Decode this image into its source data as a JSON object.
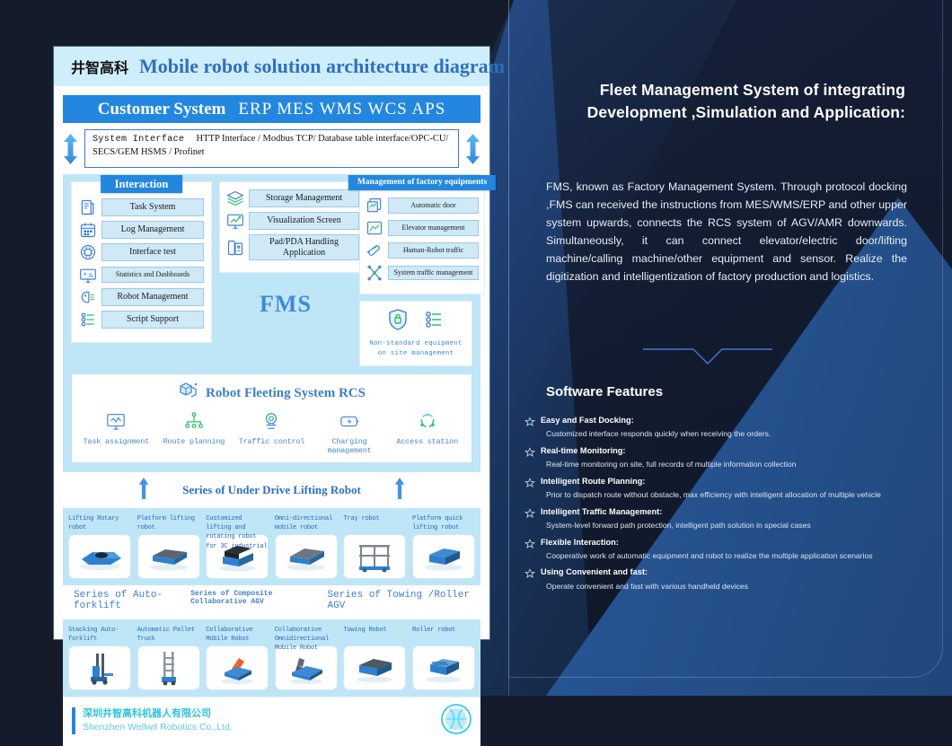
{
  "poster": {
    "brand_cn": "井智高科",
    "title": "Mobile robot solution architecture diagram",
    "customer_bar": {
      "label": "Customer System",
      "systems": "ERP  MES  WMS WCS APS"
    },
    "system_interface": {
      "label": "System Interface",
      "line1": "HTTP Interface / Modbus TCP/ Database table interface/OPC-CU/",
      "line2": "SECS/GEM HSMS / Profinet"
    },
    "fms_word": "FMS",
    "interaction": {
      "title": "Interaction",
      "items": [
        {
          "label": "Task System",
          "icon": "document-list-icon"
        },
        {
          "label": "Log Management",
          "icon": "calendar-log-icon"
        },
        {
          "label": "Interface test",
          "icon": "chip-icon"
        },
        {
          "label": "Statistics and Dashboards",
          "icon": "monitor-stats-icon"
        },
        {
          "label": "Robot Management",
          "icon": "robot-head-icon"
        },
        {
          "label": "Script Support",
          "icon": "sliders-icon"
        }
      ]
    },
    "middle": {
      "items": [
        {
          "label": "Storage Management",
          "icon": "layers-icon"
        },
        {
          "label": "Visualization Screen",
          "icon": "chart-monitor-icon"
        },
        {
          "label": "Pad/PDA Handling Application",
          "icon": "tablet-device-icon"
        }
      ]
    },
    "factory": {
      "title": "Management of factory equipments",
      "items": [
        {
          "label": "Automatic door",
          "icon": "door-panels-icon"
        },
        {
          "label": "Elevator management",
          "icon": "elevator-icon"
        },
        {
          "label": "Human-Robot traffic",
          "icon": "traffic-lanes-icon"
        },
        {
          "label": "System traffic management",
          "icon": "network-nodes-icon"
        }
      ]
    },
    "nonstandard": {
      "line1": "Non-standard equipment",
      "line2": "on site management",
      "icons": [
        "shield-lock-icon",
        "sliders-icon"
      ]
    },
    "rcs": {
      "title": "Robot Fleeting System RCS",
      "title_icon": "cubes-icon",
      "items": [
        {
          "label": "Task assignment",
          "icon": "monitor-wave-icon"
        },
        {
          "label": "Route planning",
          "icon": "hierarchy-icon"
        },
        {
          "label": "Traffic control",
          "icon": "traffic-light-icon"
        },
        {
          "label": "Charging management",
          "icon": "battery-bolt-icon"
        },
        {
          "label": "Access station",
          "icon": "dotted-circle-icon"
        }
      ]
    },
    "under_drive_series": "Series of Under Drive Lifting Robot",
    "robots_row1": [
      {
        "label": "Lifting Rotary robot"
      },
      {
        "label": "Platform lifting robot"
      },
      {
        "label": "Customized lifting and rotating robot for 3C industrial"
      },
      {
        "label": "Omni-directional mobile robot"
      },
      {
        "label": "Tray robot"
      },
      {
        "label": "Platform quick lifting robot"
      }
    ],
    "series_mid": [
      "Series of Auto-forklift",
      "Series of Composite Collaborative AGV",
      "Series of Towing /Roller AGV"
    ],
    "robots_row2": [
      {
        "label": "Stacking Auto-forklift"
      },
      {
        "label": "Automatic Pallet Truck"
      },
      {
        "label": "Collaborative Mobile Robot"
      },
      {
        "label": "Collaborative Omnidirectional Mobile Robot"
      },
      {
        "label": "Towing Robot"
      },
      {
        "label": "Roller robot"
      }
    ],
    "footer": {
      "company_cn": "深圳井智高科机器人有限公司",
      "company_en": "Shenzhen Wellwit Robotics Co.,Ltd.",
      "logo": "wellwit-logo-icon"
    }
  },
  "right": {
    "title": "Fleet Management System of  integrating Development ,Simulation and Application:",
    "paragraph": "FMS, known as Factory Management System. Through protocol docking ,FMS can received the instructions from MES/WMS/ERP and other upper system upwards, connects the RCS system of AGV/AMR downwards. Simultaneously, it can connect elevator/electric door/lifting machine/calling machine/other equipment and sensor. Realize the digitization and intelligentization of factory production and logistics.",
    "features_title": "Software Features",
    "features": [
      {
        "heading": "Easy and Fast Docking:",
        "detail": "Customized interface responds quickly when receiving the orders."
      },
      {
        "heading": "Real-time Monitoring:",
        "detail": "Real-time monitoring on site, full records of multiple information collection"
      },
      {
        "heading": "Intelligent Route Planning:",
        "detail": "Prior to dispatch route without obstacle, max efficiency with intelligent allocation of multiple vehicle"
      },
      {
        "heading": "Intelligent Traffic Management:",
        "detail": "System-level forward path protection, intelligent path solution in special cases"
      },
      {
        "heading": "Flexible Interaction:",
        "detail": "Cooperative work of automatic equipment and robot to realize the multiple application scenarios"
      },
      {
        "heading": "Using Convenient and fast:",
        "detail": "Operate convenient and fast with various handheld devices"
      }
    ]
  },
  "colors": {
    "accent_blue": "#2387e0",
    "title_blue": "#2f6fc4",
    "panel_bg": "#bfe6f7",
    "pill_bg": "#cfe9f7",
    "cyan": "#2ec4de",
    "dark_navy": "#141c2b"
  }
}
